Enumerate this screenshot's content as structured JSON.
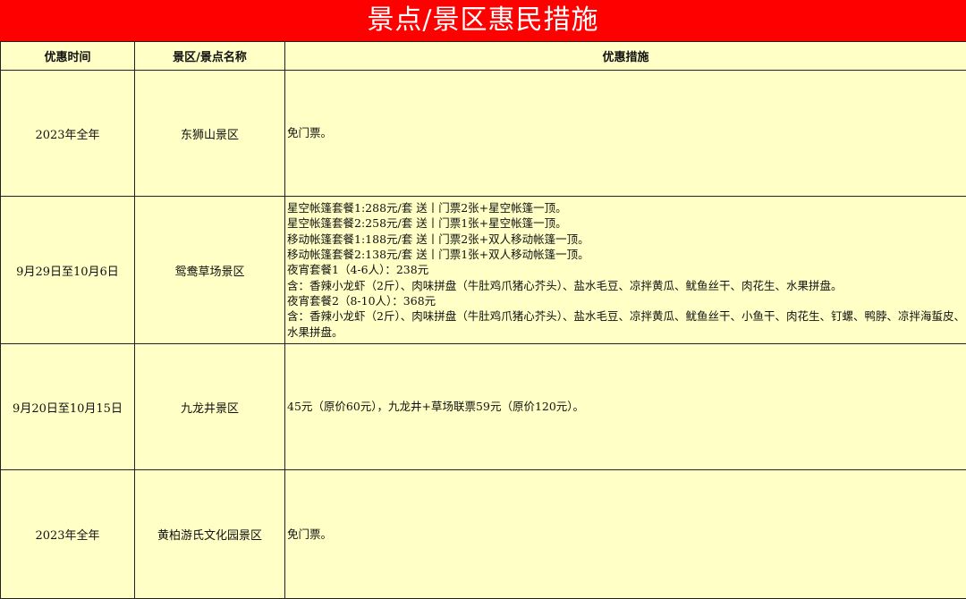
{
  "title": "景点/景区惠民措施",
  "columns": [
    "优惠时间",
    "景区/景点名称",
    "优惠措施"
  ],
  "rows": [
    {
      "time": "2023年全年",
      "name": "东狮山景区",
      "measures": [
        "免门票。"
      ]
    },
    {
      "time": "9月29日至10月6日",
      "name": "鸳鸯草场景区",
      "measures": [
        "星空帐篷套餐1:288元/套 送丨门票2张+星空帐篷一顶。",
        "星空帐篷套餐2:258元/套 送丨门票1张+星空帐篷一顶。",
        "移动帐篷套餐1:188元/套 送丨门票2张+双人移动帐篷一顶。",
        "移动帐篷套餐2:138元/套 送丨门票1张+双人移动帐篷一顶。",
        "夜宵套餐1（4-6人）：238元",
        "含：香辣小龙虾（2斤）、肉味拼盘（牛肚鸡爪猪心芥头）、盐水毛豆、凉拌黄瓜、鱿鱼丝干、肉花生、水果拼盘。",
        "夜宵套餐2（8-10人）：368元",
        "含：香辣小龙虾（2斤）、肉味拼盘（牛肚鸡爪猪心芥头）、盐水毛豆、凉拌黄瓜、鱿鱼丝干、小鱼干、肉花生、钉螺、鸭脖、凉拌海蜇皮、水果拼盘。"
      ]
    },
    {
      "time": "9月20日至10月15日",
      "name": "九龙井景区",
      "measures": [
        "45元（原价60元），九龙井+草场联票59元（原价120元）。"
      ]
    },
    {
      "time": "2023年全年",
      "name": "黄柏游氏文化园景区",
      "measures": [
        "免门票。"
      ]
    }
  ]
}
